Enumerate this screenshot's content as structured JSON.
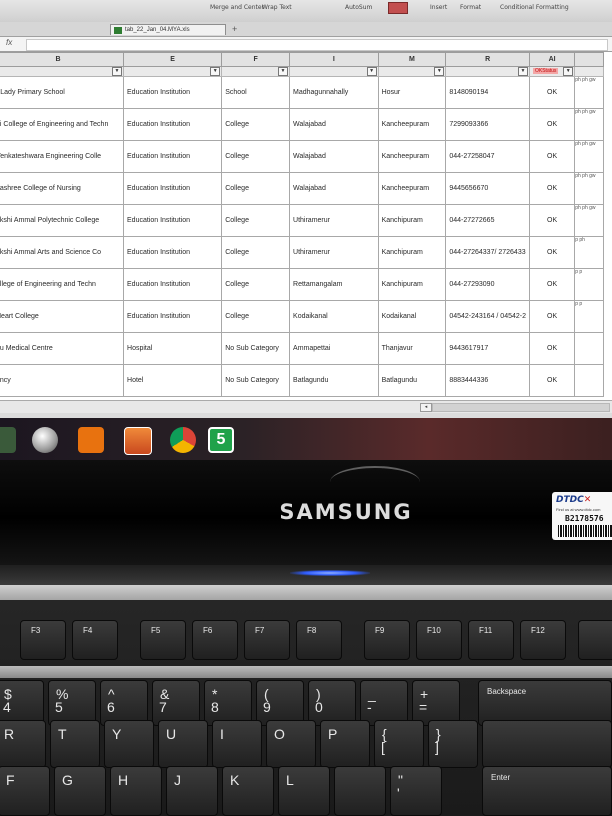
{
  "ribbon": {
    "items": [
      "Merge and Center",
      "Wrap Text",
      "AutoSum",
      "Insert",
      "Format",
      "Conditional Formatting"
    ]
  },
  "tab": {
    "filename": "tab_22_Jan_04.MYA.xls",
    "close": "+"
  },
  "formula_bar": {
    "fx": "fx"
  },
  "sheet": {
    "columns": [
      "B",
      "E",
      "F",
      "I",
      "M",
      "R",
      "AI"
    ],
    "filter_label": "OKStatus",
    "rows": [
      [
        "r Lady Primary School",
        "Education Institution",
        "School",
        "Madhagunnahally",
        "Hosur",
        "8148090194",
        "OK"
      ],
      [
        "ai College of Engineering and Techn",
        "Education Institution",
        "College",
        "Walajabad",
        "Kancheepuram",
        "7299093366",
        "OK"
      ],
      [
        "Venkateshwara Engineering Colle",
        "Education Institution",
        "College",
        "Walajabad",
        "Kancheepuram",
        "044-27258047",
        "OK"
      ],
      [
        "nashree College of Nursing",
        "Education Institution",
        "College",
        "Walajabad",
        "Kancheepuram",
        "9445656670",
        "OK"
      ],
      [
        "akshi Ammal Polytechnic College",
        "Education Institution",
        "College",
        "Uthiramerur",
        "Kanchipuram",
        "044-27272665",
        "OK"
      ],
      [
        "akshi Ammal Arts and Science Co",
        "Education Institution",
        "College",
        "Uthiramerur",
        "Kanchipuram",
        "044-27264337/ 2726433",
        "OK"
      ],
      [
        "ollege of Engineering and Techn",
        "Education Institution",
        "College",
        "Rettamangalam",
        "Kanchipuram",
        "044-27293090",
        "OK"
      ],
      [
        "Heart College",
        "Education Institution",
        "College",
        "Kodaikanal",
        "Kodaikanal",
        "04542-243164 / 04542-2",
        "OK"
      ],
      [
        "du Medical Centre",
        "Hospital",
        "No Sub Category",
        "Ammapettai",
        "Thanjavur",
        "9443617917",
        "OK"
      ],
      [
        "ency",
        "Hotel",
        "No Sub Category",
        "Batlagundu",
        "Batlagundu",
        "8883444336",
        "OK"
      ]
    ],
    "extra_col": [
      "ph ph gw",
      "ph ph gw",
      "ph ph gw",
      "ph ph gw",
      "ph ph gw",
      "p ph",
      "p p",
      "p p",
      "",
      ""
    ]
  },
  "taskbar": {
    "app5_label": "5"
  },
  "monitor": {
    "brand": "SAMSUNG",
    "sticker_brand": "DTDC",
    "sticker_fine": "Find us at www.dtdc.com",
    "sticker_number": "B2178576"
  },
  "keyboard": {
    "fkeys": [
      "F3",
      "F4",
      "F5",
      "F6",
      "F7",
      "F8",
      "F9",
      "F10",
      "F11",
      "F12"
    ],
    "num_row": [
      {
        "top": "$",
        "bottom": "4"
      },
      {
        "top": "%",
        "bottom": "5"
      },
      {
        "top": "^",
        "bottom": "6"
      },
      {
        "top": "&",
        "bottom": "7"
      },
      {
        "top": "*",
        "bottom": "8"
      },
      {
        "top": "(",
        "bottom": "9"
      },
      {
        "top": ")",
        "bottom": "0"
      },
      {
        "top": "_",
        "bottom": "-"
      },
      {
        "top": "+",
        "bottom": "="
      }
    ],
    "backspace": "Backspace",
    "row_q": [
      "R",
      "T",
      "Y",
      "U",
      "I",
      "O",
      "P"
    ],
    "row_q_brackets": [
      {
        "top": "{",
        "bottom": "["
      },
      {
        "top": "}",
        "bottom": "]"
      }
    ],
    "row_a": [
      "F",
      "G",
      "H",
      "J",
      "K",
      "L"
    ],
    "row_a_quote": {
      "top": "\"",
      "bottom": "'"
    },
    "enter": "Enter"
  },
  "colors": {
    "sheet_header": "#e2e2e2",
    "filter_highlight": "#f3a6a6",
    "led": "#2f5cff",
    "sticker_red": "#c81e1e"
  }
}
